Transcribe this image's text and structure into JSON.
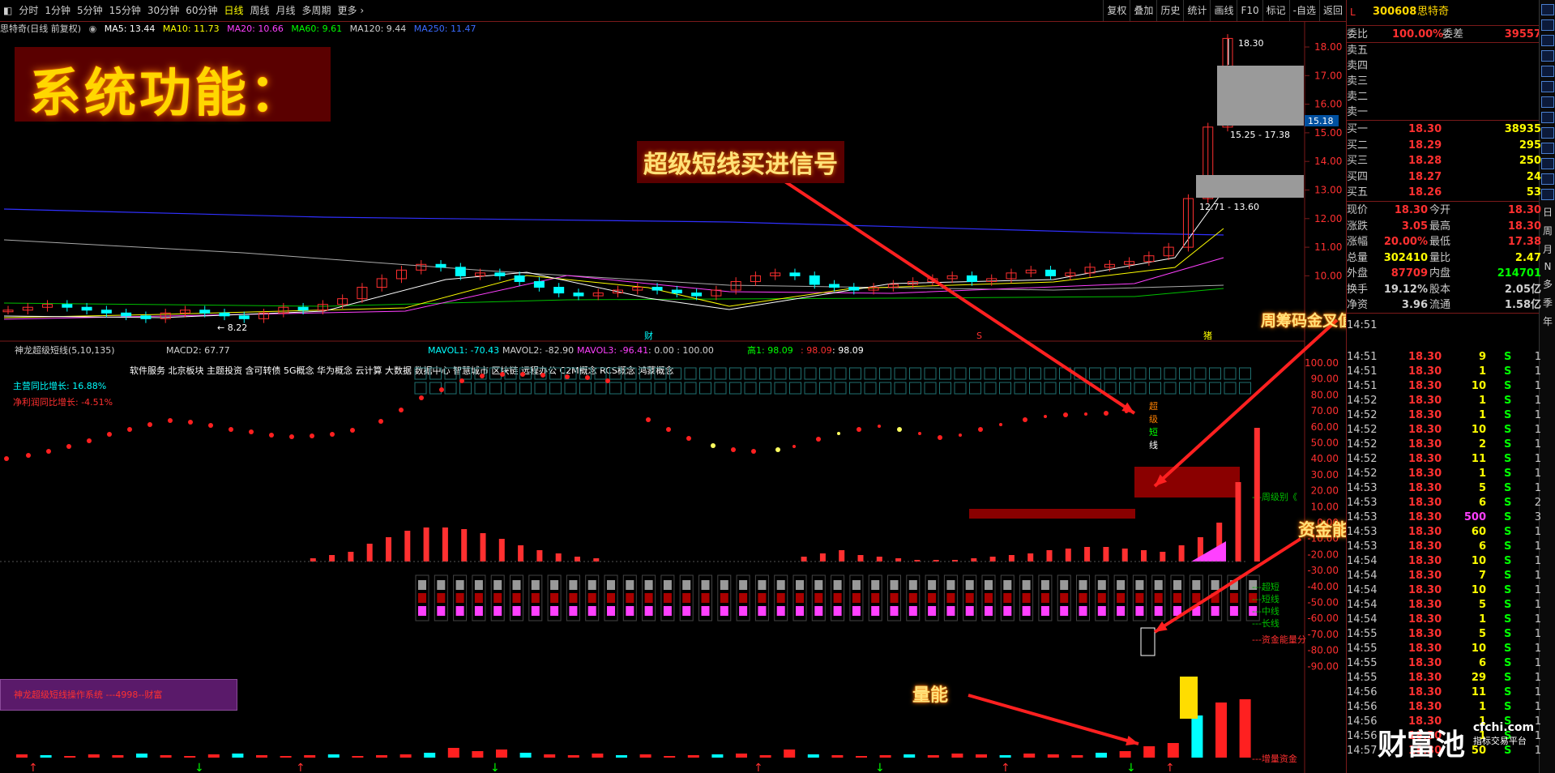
{
  "toolbar": {
    "periods": [
      "分时",
      "1分钟",
      "5分钟",
      "15分钟",
      "30分钟",
      "60分钟",
      "日线",
      "周线",
      "月线",
      "多周期",
      "更多"
    ],
    "active": "日线",
    "right_items": [
      "复权",
      "叠加",
      "历史",
      "统计",
      "画线",
      "F10",
      "标记",
      "-自选",
      "返回"
    ]
  },
  "legend": {
    "stock": "思特奇(日线 前复权)",
    "ma5": "MA5: 13.44",
    "ma10": "MA10: 11.73",
    "ma20": "MA20: 10.66",
    "ma60": "MA60: 9.61",
    "ma120": "MA120: 9.44",
    "ma250": "MA250: 11.47"
  },
  "colors": {
    "ma5": "#ffffff",
    "ma10": "#ffff00",
    "ma20": "#ff40ff",
    "ma60": "#00ff00",
    "ma120": "#c8c8c8",
    "ma250": "#3030ff",
    "up": "#ff3030",
    "down": "#00ffff",
    "accent": "#ffd700"
  },
  "banner": {
    "text": "系统功能："
  },
  "callouts": {
    "buy_signal": "超级短线买进信号",
    "chip": "周筹码金叉值在中位比较安稳",
    "fund": "资金能量信号",
    "volume": "量能"
  },
  "price_axis": [
    "18.00",
    "17.00",
    "16.00",
    "15.00",
    "14.00",
    "13.00",
    "12.00",
    "11.00",
    "10.00"
  ],
  "price_current": "15.18",
  "price_labels": {
    "high": "18.30",
    "low": "8.22",
    "zone1": "15.25 - 17.38",
    "zone2": "12.71 - 13.60"
  },
  "markers": {
    "cai": "财",
    "s": "S",
    "zhu": "猪"
  },
  "indicator": {
    "title": "神龙超级短线(5,10,135)",
    "macd2": "MACD2: 67.77",
    "mavol1": "MAVOL1: -70.43",
    "mavol2": "MAVOL2: -82.90",
    "mavol3": "MAVOL3: -96.41",
    "mavol_tail": ": 0.00 : 100.00",
    "gao": "高1: 98.09",
    "v2": ": 98.09",
    "v3": ": 98.09",
    "concepts": "软件服务 北京板块 主题投资 含可转债 5G概念 华为概念 云计算 大数据 数据中心 智慧城市 区块链 远程办公 C2M概念 RCS概念 鸿蒙概念",
    "growth1": "主营同比增长: 16.88%",
    "growth2": "净利润同比增长: -4.51%",
    "system_label": "神龙超级短线操作系统 ---4998--财富",
    "vertical_label": [
      "超",
      "级",
      "短",
      "线"
    ],
    "zhouji": "---周级别《",
    "lines": [
      "---超短",
      "---短线",
      "---中线",
      "---长线"
    ],
    "fund_label": "---资金能量分",
    "vol_label": "---增量资金",
    "axis": [
      "100.00",
      "90.00",
      "80.00",
      "70.00",
      "60.00",
      "50.00",
      "40.00",
      "30.00",
      "20.00",
      "10.00",
      "0.00",
      "-10.00",
      "-20.00",
      "-30.00",
      "-40.00",
      "-50.00",
      "-60.00",
      "-70.00",
      "-80.00",
      "-90.00"
    ]
  },
  "quote": {
    "code": "300608",
    "name": "思特奇",
    "weibi_label": "委比",
    "weibi": "100.00%",
    "weicha_label": "委差",
    "weicha": "39557",
    "sell": [
      [
        "卖五",
        ""
      ],
      [
        "卖四",
        ""
      ],
      [
        "卖三",
        ""
      ],
      [
        "卖二",
        ""
      ],
      [
        "卖一",
        ""
      ]
    ],
    "buy": [
      [
        "买一",
        "18.30",
        "38935"
      ],
      [
        "买二",
        "18.29",
        "295"
      ],
      [
        "买三",
        "18.28",
        "250"
      ],
      [
        "买四",
        "18.27",
        "24"
      ],
      [
        "买五",
        "18.26",
        "53"
      ]
    ],
    "stats": [
      [
        "现价",
        "18.30",
        "今开",
        "18.30"
      ],
      [
        "涨跌",
        "3.05",
        "最高",
        "18.30"
      ],
      [
        "涨幅",
        "20.00%",
        "最低",
        "17.38"
      ],
      [
        "总量",
        "302410",
        "量比",
        "2.47"
      ],
      [
        "外盘",
        "87709",
        "内盘",
        "214701"
      ],
      [
        "换手",
        "19.12%",
        "股本",
        "2.05亿"
      ],
      [
        "净资",
        "3.96",
        "流通",
        "1.58亿"
      ]
    ],
    "ticks": [
      [
        "14:51",
        "18.30",
        "9",
        "S",
        "1"
      ],
      [
        "14:51",
        "18.30",
        "1",
        "S",
        "1"
      ],
      [
        "14:51",
        "18.30",
        "10",
        "S",
        "1"
      ],
      [
        "14:52",
        "18.30",
        "1",
        "S",
        "1"
      ],
      [
        "14:52",
        "18.30",
        "1",
        "S",
        "1"
      ],
      [
        "14:52",
        "18.30",
        "10",
        "S",
        "1"
      ],
      [
        "14:52",
        "18.30",
        "2",
        "S",
        "1"
      ],
      [
        "14:52",
        "18.30",
        "11",
        "S",
        "1"
      ],
      [
        "14:52",
        "18.30",
        "1",
        "S",
        "1"
      ],
      [
        "14:53",
        "18.30",
        "5",
        "S",
        "1"
      ],
      [
        "14:53",
        "18.30",
        "6",
        "S",
        "2"
      ],
      [
        "14:53",
        "18.30",
        "500",
        "S",
        "3"
      ],
      [
        "14:53",
        "18.30",
        "60",
        "S",
        "1"
      ],
      [
        "14:53",
        "18.30",
        "6",
        "S",
        "1"
      ],
      [
        "14:54",
        "18.30",
        "10",
        "S",
        "1"
      ],
      [
        "14:54",
        "18.30",
        "7",
        "S",
        "1"
      ],
      [
        "14:54",
        "18.30",
        "10",
        "S",
        "1"
      ],
      [
        "14:54",
        "18.30",
        "5",
        "S",
        "1"
      ],
      [
        "14:54",
        "18.30",
        "1",
        "S",
        "1"
      ],
      [
        "14:55",
        "18.30",
        "5",
        "S",
        "1"
      ],
      [
        "14:55",
        "18.30",
        "10",
        "S",
        "1"
      ],
      [
        "14:55",
        "18.30",
        "6",
        "S",
        "1"
      ],
      [
        "14:55",
        "18.30",
        "29",
        "S",
        "1"
      ],
      [
        "14:56",
        "18.30",
        "11",
        "S",
        "1"
      ],
      [
        "14:56",
        "18.30",
        "1",
        "S",
        "1"
      ],
      [
        "14:56",
        "18.30",
        "1",
        "S",
        "1"
      ],
      [
        "14:56",
        "18.30",
        "1",
        "S",
        "1"
      ],
      [
        "14:57",
        "18.30",
        "50",
        "S",
        "1"
      ]
    ]
  },
  "sidebar_text": [
    "日",
    "周",
    "月",
    "N",
    "多",
    "季",
    "年"
  ],
  "watermark": {
    "brand": "财富池",
    "site": "cfchi.com",
    "sub": "指标交易平台"
  },
  "chart_data": {
    "type": "candlestick",
    "price_axis": [
      10,
      18
    ],
    "closes": [
      8.8,
      8.9,
      9.0,
      8.9,
      8.8,
      8.7,
      8.6,
      8.5,
      8.7,
      8.8,
      8.7,
      8.6,
      8.5,
      8.7,
      8.9,
      8.8,
      9.0,
      9.2,
      9.6,
      9.9,
      10.2,
      10.4,
      10.3,
      10.0,
      10.1,
      10.0,
      9.8,
      9.6,
      9.4,
      9.3,
      9.4,
      9.5,
      9.6,
      9.5,
      9.4,
      9.3,
      9.5,
      9.8,
      10.0,
      10.1,
      10.0,
      9.7,
      9.6,
      9.5,
      9.6,
      9.7,
      9.8,
      9.9,
      10.0,
      9.8,
      9.9,
      10.1,
      10.2,
      10.0,
      10.1,
      10.3,
      10.4,
      10.5,
      10.7,
      11.0,
      12.7,
      15.2,
      18.3
    ]
  }
}
